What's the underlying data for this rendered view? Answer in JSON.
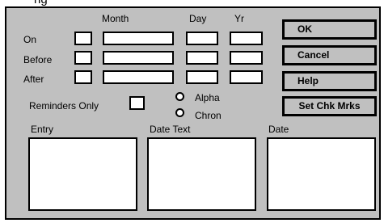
{
  "window": {
    "title_fragment": "ng"
  },
  "columns": {
    "month": "Month",
    "day": "Day",
    "yr": "Yr"
  },
  "rows": {
    "on": "On",
    "before": "Before",
    "after": "After"
  },
  "reminders_only": "Reminders Only",
  "sort": {
    "alpha": "Alpha",
    "chron": "Chron"
  },
  "buttons": {
    "ok": "OK",
    "cancel": "Cancel",
    "help": "Help",
    "set_chk_mrks": "Set Chk Mrks"
  },
  "lists": {
    "entry": "Entry",
    "date_text": "Date Text",
    "date": "Date"
  }
}
